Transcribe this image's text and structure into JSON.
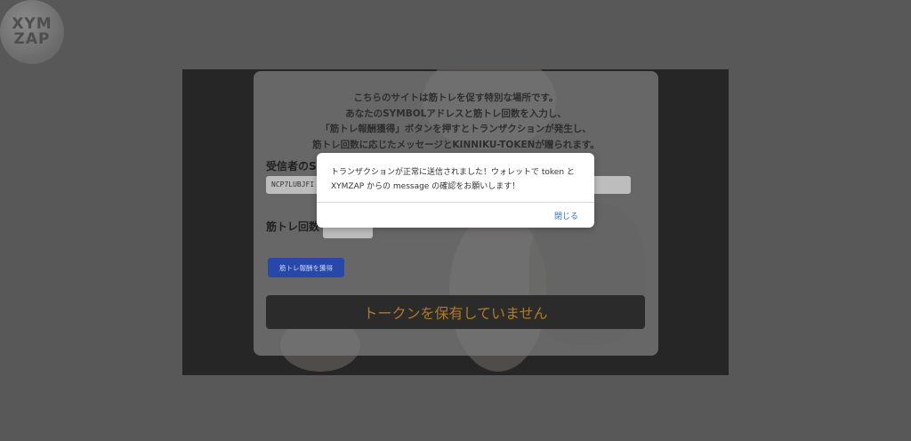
{
  "logo": {
    "line1": "XYM",
    "line2": "ZAP"
  },
  "intro": {
    "line1": "こちらのサイトは筋トレを促す特別な場所です。",
    "line2": "あなたのSYMBOLアドレスと筋トレ回数を入力し、",
    "line3": "「筋トレ報酬獲得」ボタンを押すとトランザクションが発生し、",
    "line4": "筋トレ回数に応じたメッセージとKINNIKU-TOKENが贈られます。"
  },
  "form": {
    "address_label": "受信者のSY",
    "address_value": "NCP7LUBJFI",
    "count_label": "筋トレ回数",
    "earn_button": "筋トレ報酬を獲得"
  },
  "token_status": "トークンを保有していません",
  "dialog": {
    "message_line1": "トランザクションが正常に送信されました！ウォレットで token と",
    "message_line2": "XYMZAP からの message の確認をお願いします！",
    "close_label": "閉じる"
  },
  "colors": {
    "overlay": "#585858",
    "button": "#2748a8",
    "token_text": "#b07a25",
    "link": "#2f6fd6"
  },
  "icons": {
    "logo": "xymzap-logo"
  }
}
